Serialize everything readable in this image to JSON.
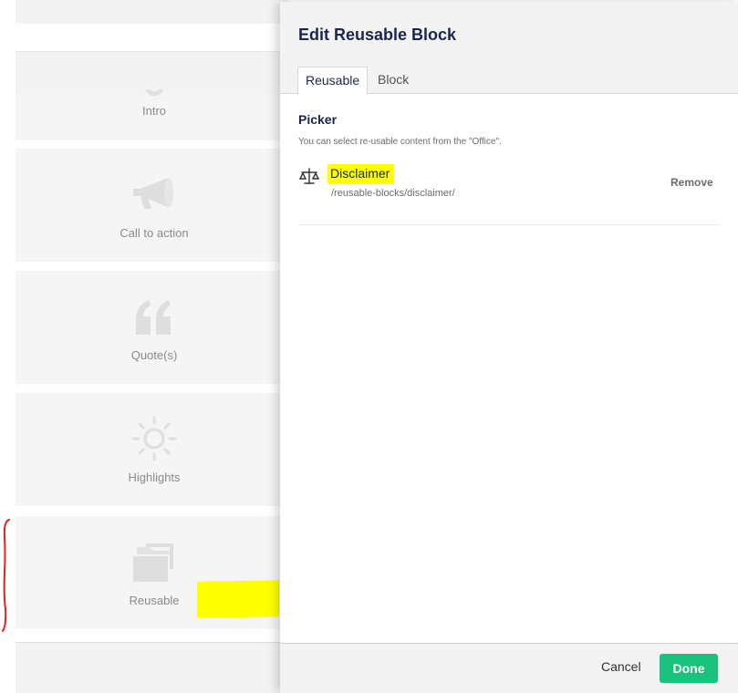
{
  "blocks": [
    {
      "label": "Intro",
      "icon": "megaphone-icon"
    },
    {
      "label": "Call to action",
      "icon": "megaphone-icon"
    },
    {
      "label": "Quote(s)",
      "icon": "quote-icon"
    },
    {
      "label": "Highlights",
      "icon": "sun-icon"
    },
    {
      "label": "Reusable",
      "icon": "folder-icon"
    }
  ],
  "dialog": {
    "title": "Edit Reusable Block",
    "tabs": [
      "Reusable",
      "Block"
    ],
    "picker": {
      "label": "Picker",
      "description": "You can select re-usable content from the \"Office\".",
      "item": {
        "name": "Disclaimer",
        "path": "/reusable-blocks/disclaimer/",
        "icon": "scale-icon",
        "remove_label": "Remove"
      }
    },
    "footer": {
      "cancel_label": "Cancel",
      "done_label": "Done"
    }
  },
  "colors": {
    "accent": "#1ac27e",
    "highlight": "#ffff00",
    "annotation": "#e0231a",
    "title": "#1b264f"
  }
}
